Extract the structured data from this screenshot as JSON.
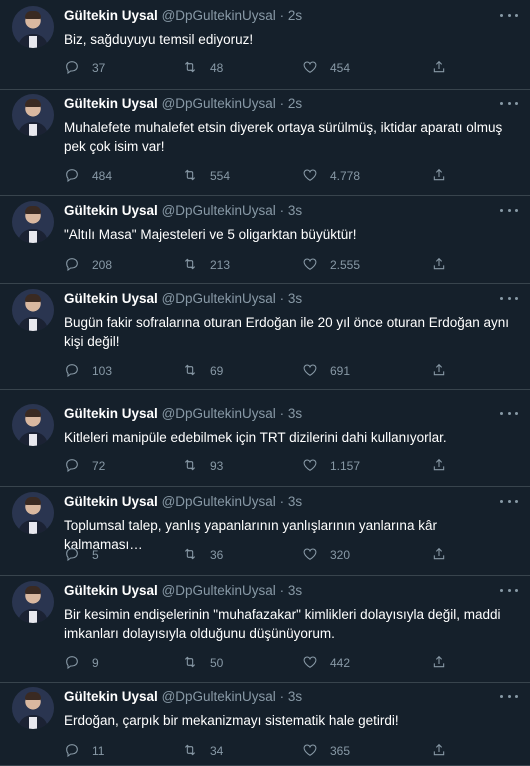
{
  "colors": {
    "background": "#15202b",
    "text": "#ffffff",
    "muted": "#8899a6",
    "divider": "#38444d"
  },
  "tweets": [
    {
      "name": "Gültekin Uysal",
      "handle": "@DpGultekinUysal",
      "time": "2s",
      "text": "Biz, sağduyuyu temsil ediyoruz!",
      "replies": "37",
      "retweets": "48",
      "likes": "454"
    },
    {
      "name": "Gültekin Uysal",
      "handle": "@DpGultekinUysal",
      "time": "2s",
      "text": "Muhalefete muhalefet etsin diyerek ortaya sürülmüş, iktidar aparatı olmuş pek çok isim var!",
      "replies": "484",
      "retweets": "554",
      "likes": "4.778"
    },
    {
      "name": "Gültekin Uysal",
      "handle": "@DpGultekinUysal",
      "time": "3s",
      "text": "\"Altılı Masa\" Majesteleri ve 5 oligarktan büyüktür!",
      "replies": "208",
      "retweets": "213",
      "likes": "2.555"
    },
    {
      "name": "Gültekin Uysal",
      "handle": "@DpGultekinUysal",
      "time": "3s",
      "text": "Bugün fakir sofralarına oturan Erdoğan ile 20 yıl önce oturan Erdoğan aynı kişi değil!",
      "replies": "103",
      "retweets": "69",
      "likes": "691"
    },
    {
      "name": "Gültekin Uysal",
      "handle": "@DpGultekinUysal",
      "time": "3s",
      "text": "Kitleleri manipüle edebilmek için TRT dizilerini dahi kullanıyorlar.",
      "replies": "72",
      "retweets": "93",
      "likes": "1.157"
    },
    {
      "name": "Gültekin Uysal",
      "handle": "@DpGultekinUysal",
      "time": "3s",
      "text": "Toplumsal talep, yanlış yapanlarının yanlışlarının yanlarına kâr kalmaması…",
      "replies": "5",
      "retweets": "36",
      "likes": "320"
    },
    {
      "name": "Gültekin Uysal",
      "handle": "@DpGultekinUysal",
      "time": "3s",
      "text": "Bir kesimin endişelerinin \"muhafazakar\" kimlikleri dolayısıyla değil, maddi imkanları dolayısıyla olduğunu düşünüyorum.",
      "replies": "9",
      "retweets": "50",
      "likes": "442"
    },
    {
      "name": "Gültekin Uysal",
      "handle": "@DpGultekinUysal",
      "time": "3s",
      "text": "Erdoğan, çarpık bir mekanizmayı sistematik hale getirdi!",
      "replies": "11",
      "retweets": "34",
      "likes": "365"
    }
  ],
  "icons": {
    "reply": "reply-icon",
    "retweet": "retweet-icon",
    "like": "like-icon",
    "share": "share-icon",
    "more": "more-icon"
  }
}
